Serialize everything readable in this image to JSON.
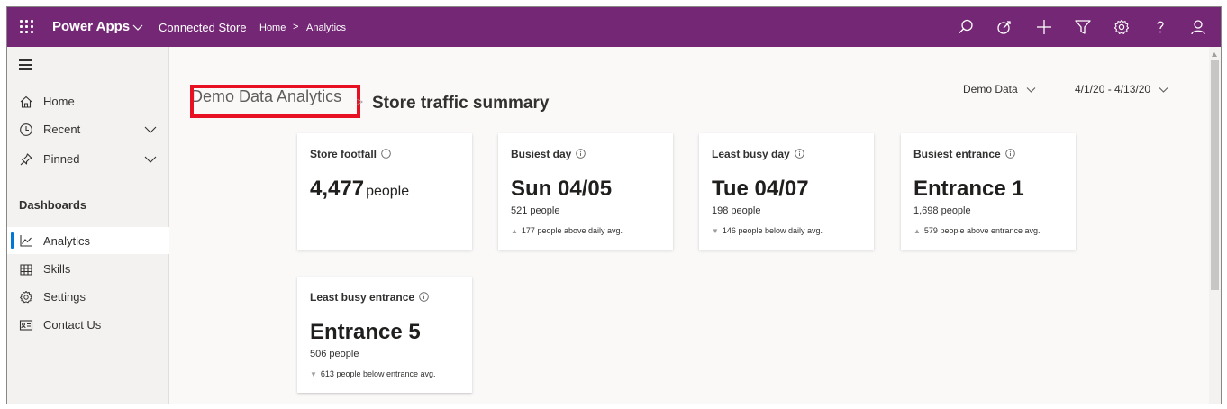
{
  "topbar": {
    "app_name": "Power Apps",
    "store_name": "Connected Store",
    "breadcrumb_home": "Home",
    "breadcrumb_sep": ">",
    "breadcrumb_current": "Analytics",
    "icons": [
      "search-icon",
      "target-icon",
      "add-icon",
      "filter-icon",
      "settings-icon",
      "help-icon",
      "user-icon"
    ]
  },
  "sidebar": {
    "items": [
      {
        "label": "Home",
        "icon": "home-icon"
      },
      {
        "label": "Recent",
        "icon": "clock-icon"
      },
      {
        "label": "Pinned",
        "icon": "pin-icon"
      }
    ],
    "section_header": "Dashboards",
    "dashboards": [
      {
        "label": "Analytics",
        "icon": "chart-line-icon",
        "active": true
      },
      {
        "label": "Skills",
        "icon": "grid-icon"
      },
      {
        "label": "Settings",
        "icon": "gear-icon"
      },
      {
        "label": "Contact Us",
        "icon": "contact-card-icon"
      }
    ]
  },
  "main": {
    "breadcrumb_link": "Demo Data Analytics",
    "breadcrumb_sep": ">",
    "page_title": "Store traffic summary",
    "filter_data": "Demo Data",
    "filter_dates": "4/1/20 - 4/13/20",
    "cards": [
      {
        "title": "Store footfall",
        "value": "4,477",
        "unit": "people",
        "sub": "",
        "trend": ""
      },
      {
        "title": "Busiest day",
        "value": "Sun 04/05",
        "unit": "",
        "sub": "521 people",
        "trend": "177 people above daily avg.",
        "direction": "up"
      },
      {
        "title": "Least busy day",
        "value": "Tue 04/07",
        "unit": "",
        "sub": "198 people",
        "trend": "146 people below daily avg.",
        "direction": "down"
      },
      {
        "title": "Busiest entrance",
        "value": "Entrance 1",
        "unit": "",
        "sub": "1,698 people",
        "trend": "579 people above entrance avg.",
        "direction": "up"
      },
      {
        "title": "Least busy entrance",
        "value": "Entrance 5",
        "unit": "",
        "sub": "506 people",
        "trend": "613 people below entrance avg.",
        "direction": "down"
      }
    ]
  },
  "colors": {
    "topbar": "#742774",
    "active_indicator": "#0078d4",
    "highlight_box": "#e81123"
  }
}
